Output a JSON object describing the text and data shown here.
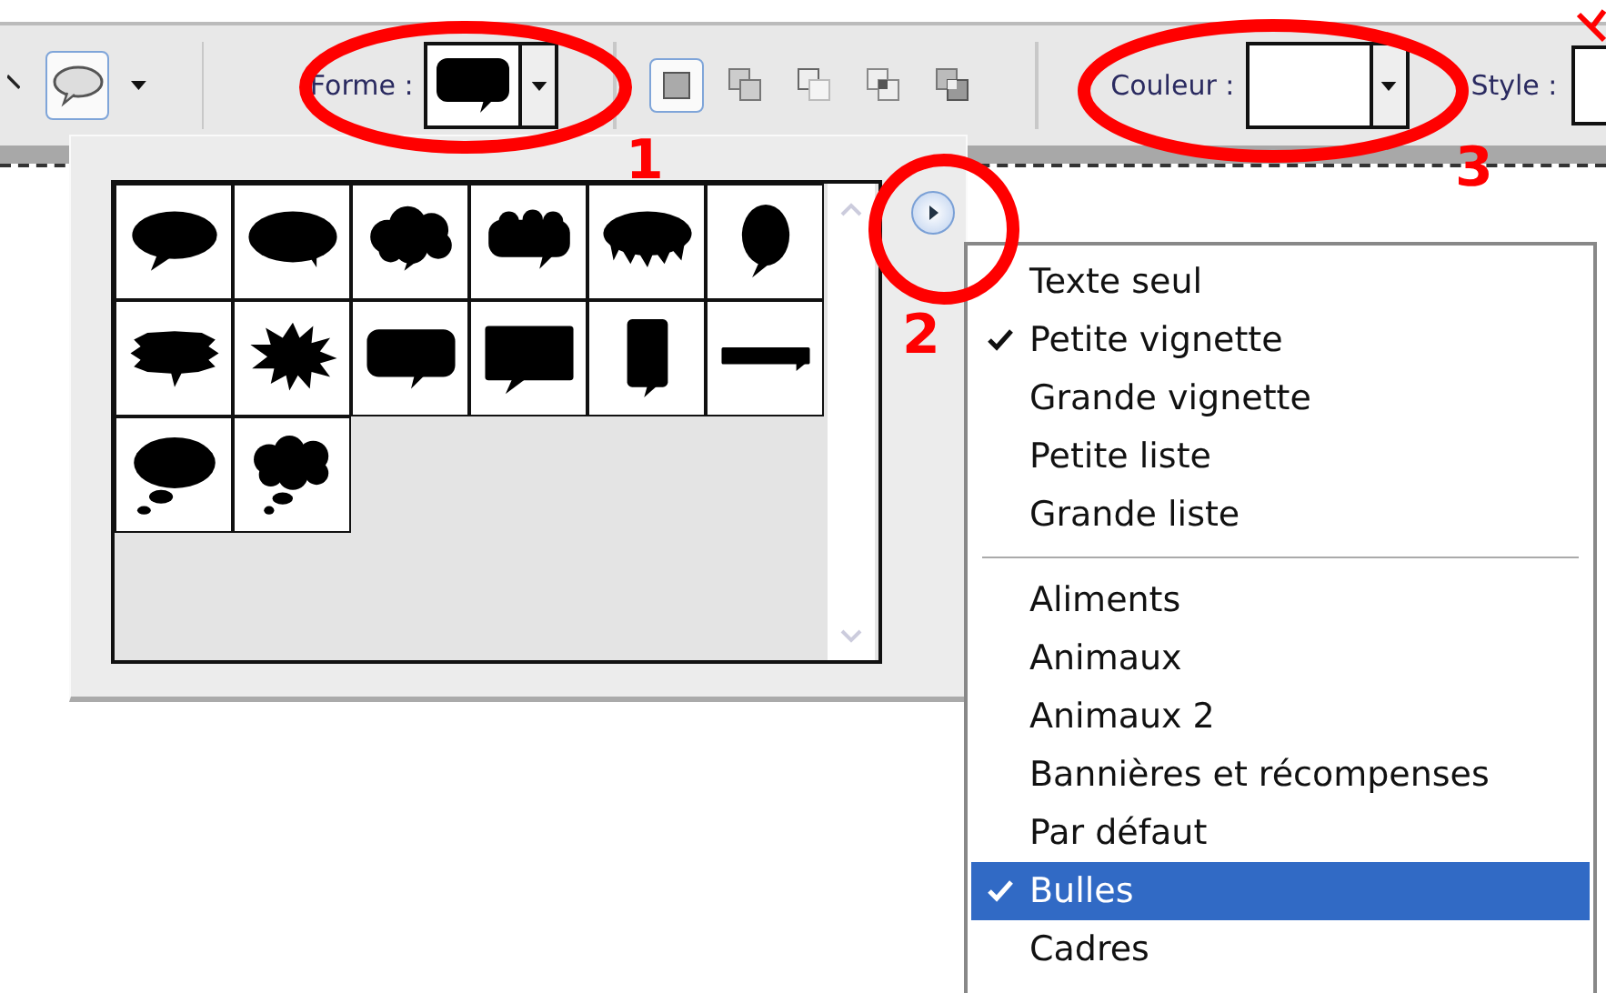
{
  "toolbar": {
    "forme_label": "Forme :",
    "couleur_label": "Couleur :",
    "style_label": "Style :"
  },
  "mode_buttons": [
    {
      "kind": "new",
      "selected": true
    },
    {
      "kind": "add",
      "selected": false
    },
    {
      "kind": "subtract",
      "selected": false
    },
    {
      "kind": "intersect",
      "selected": false
    },
    {
      "kind": "exclude",
      "selected": false
    }
  ],
  "annotations": [
    {
      "label": "1"
    },
    {
      "label": "2"
    },
    {
      "label": "3"
    }
  ],
  "shapes": [
    {
      "kind": "oval"
    },
    {
      "kind": "wide-oval"
    },
    {
      "kind": "cloud"
    },
    {
      "kind": "cloud-flat"
    },
    {
      "kind": "ragged"
    },
    {
      "kind": "tall-oval"
    },
    {
      "kind": "rough-oval"
    },
    {
      "kind": "burst"
    },
    {
      "kind": "rounded-rect"
    },
    {
      "kind": "rect"
    },
    {
      "kind": "tall-rect"
    },
    {
      "kind": "bar"
    },
    {
      "kind": "thought"
    },
    {
      "kind": "thought-cloud"
    }
  ],
  "menu": {
    "sections": [
      [
        {
          "label": "Texte seul",
          "checked": false,
          "selected": false
        },
        {
          "label": "Petite vignette",
          "checked": true,
          "selected": false
        },
        {
          "label": "Grande vignette",
          "checked": false,
          "selected": false
        },
        {
          "label": "Petite liste",
          "checked": false,
          "selected": false
        },
        {
          "label": "Grande liste",
          "checked": false,
          "selected": false
        }
      ],
      [
        {
          "label": "Aliments",
          "checked": false,
          "selected": false
        },
        {
          "label": "Animaux",
          "checked": false,
          "selected": false
        },
        {
          "label": "Animaux 2",
          "checked": false,
          "selected": false
        },
        {
          "label": "Bannières et récompenses",
          "checked": false,
          "selected": false
        },
        {
          "label": "Par défaut",
          "checked": false,
          "selected": false
        },
        {
          "label": "Bulles",
          "checked": true,
          "selected": true
        },
        {
          "label": "Cadres",
          "checked": false,
          "selected": false
        }
      ]
    ]
  }
}
